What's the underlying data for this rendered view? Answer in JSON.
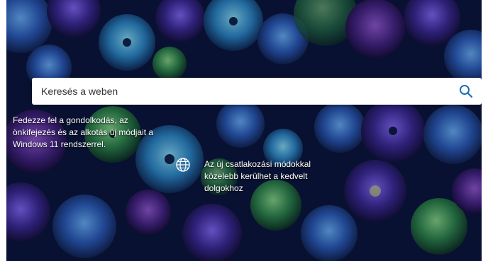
{
  "search": {
    "placeholder": "Keresés a weben"
  },
  "promo_left": {
    "text": "Fedezze fel a gondolkodás, az önkifejezés és az alkotás új módjait a Windows 11 rendszerrel."
  },
  "promo_right": {
    "text": "Az új csatlakozási módokkal közelebb kerülhet a kedvelt dolgokhoz",
    "icon": "globe-icon"
  },
  "colors": {
    "background": "#0a1233",
    "search_icon": "#1a6fb8",
    "text": "#ffffff"
  }
}
